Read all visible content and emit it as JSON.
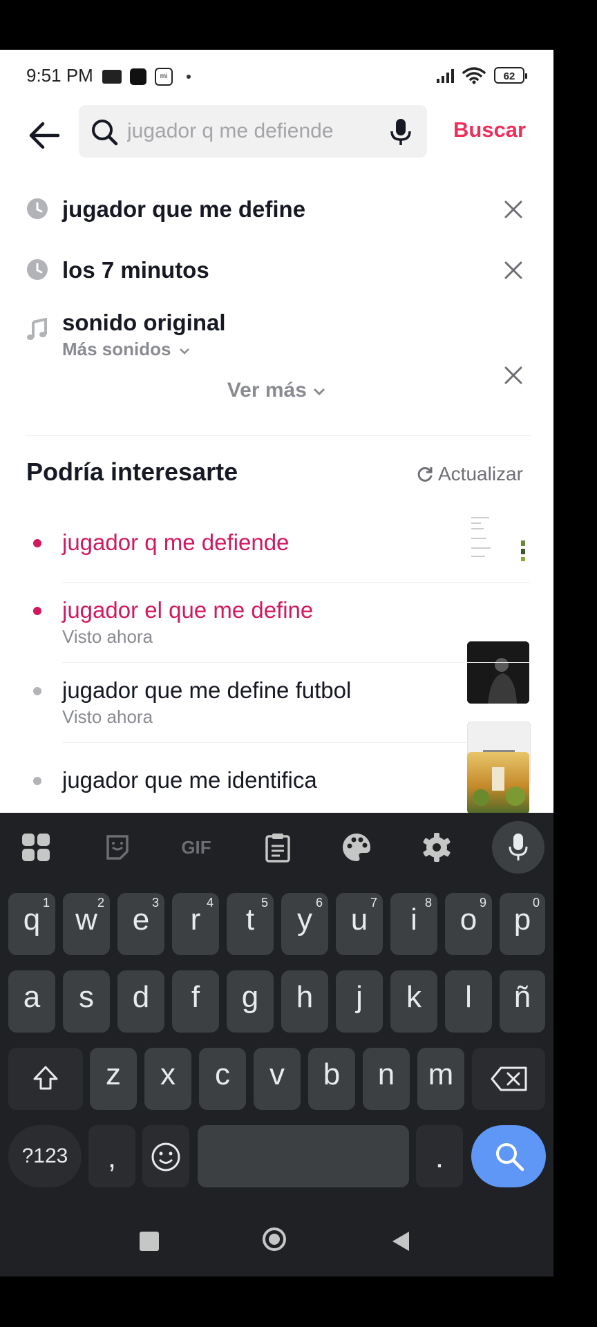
{
  "status_bar": {
    "time": "9:51 PM",
    "battery": "62"
  },
  "search": {
    "placeholder": "jugador q me defiende",
    "submit_label": "Buscar"
  },
  "history": [
    {
      "icon": "clock-icon",
      "label": "jugador que me define"
    },
    {
      "icon": "clock-icon",
      "label": "los 7 minutos"
    },
    {
      "icon": "music-note-icon",
      "label": "sonido original",
      "sub": "Más sonidos"
    }
  ],
  "see_more": "Ver más",
  "suggestions_section": {
    "title": "Podría interesarte",
    "refresh_label": "Actualizar"
  },
  "suggestions": [
    {
      "label": "jugador q me defiende",
      "sub": "",
      "highlight": true
    },
    {
      "label": "jugador el que me define",
      "sub": "Visto ahora",
      "highlight": true
    },
    {
      "label": "jugador que me define futbol",
      "sub": "Visto ahora",
      "highlight": false
    },
    {
      "label": "jugador que me identifica",
      "sub": "",
      "highlight": false
    }
  ],
  "keyboard": {
    "toolbar": [
      "apps-grid-icon",
      "sticker-icon",
      "GIF",
      "clipboard-icon",
      "palette-icon",
      "settings-icon",
      "microphone-icon"
    ],
    "row1": [
      [
        "q",
        "1"
      ],
      [
        "w",
        "2"
      ],
      [
        "e",
        "3"
      ],
      [
        "r",
        "4"
      ],
      [
        "t",
        "5"
      ],
      [
        "y",
        "6"
      ],
      [
        "u",
        "7"
      ],
      [
        "i",
        "8"
      ],
      [
        "o",
        "9"
      ],
      [
        "p",
        "0"
      ]
    ],
    "row2": [
      "a",
      "s",
      "d",
      "f",
      "g",
      "h",
      "j",
      "k",
      "l",
      "ñ"
    ],
    "row3": [
      "z",
      "x",
      "c",
      "v",
      "b",
      "n",
      "m"
    ],
    "symbols_label": "?123",
    "comma": ",",
    "period": "."
  },
  "colors": {
    "accent": "#ee2f5c",
    "suggest_red": "#d1195f",
    "keyboard_bg": "#202124",
    "key_bg": "#3c4043",
    "search_key": "#5e97f6"
  }
}
